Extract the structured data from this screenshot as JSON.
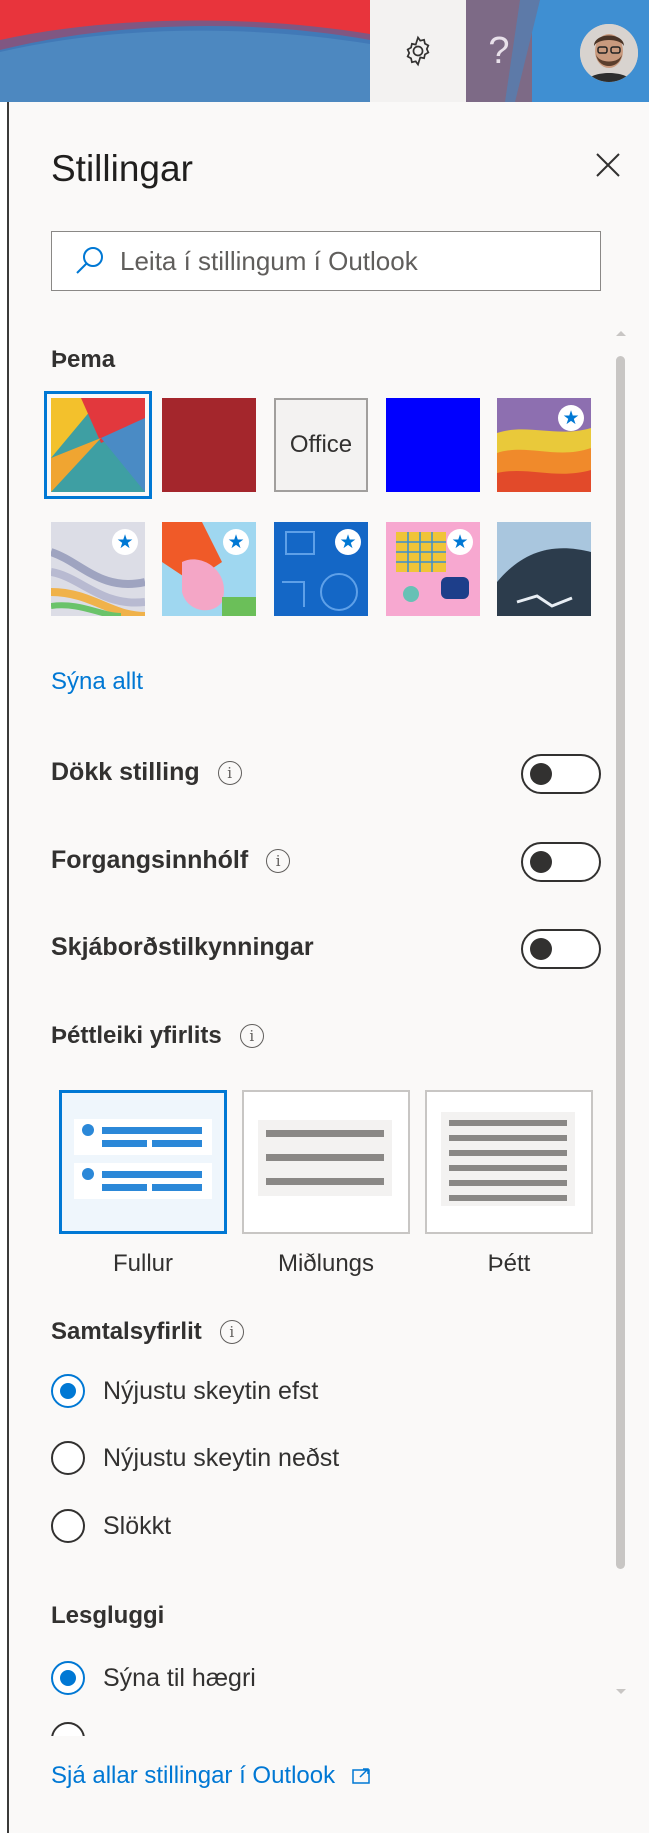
{
  "header": {
    "gear_label": "Settings",
    "help_label": "?",
    "colors": {
      "red": "#e8303a",
      "blue": "#4a86c5",
      "purple": "#7c6a87"
    }
  },
  "settings": {
    "title": "Stillingar",
    "close_icon": "close-icon",
    "search": {
      "placeholder": "Leita í stillingum í Outlook"
    },
    "theme": {
      "heading": "Þema",
      "office_label": "Office",
      "show_all": "Sýna allt"
    },
    "toggles": [
      {
        "label": "Dökk stilling",
        "info": "i",
        "on": false
      },
      {
        "label": "Forgangsinnhólf",
        "info": "i",
        "on": false
      },
      {
        "label": "Skjáborðstilkynningar",
        "on": false
      }
    ],
    "density": {
      "heading": "Þéttleiki yfirlits",
      "info": "i",
      "options": [
        "Fullur",
        "Miðlungs",
        "Þétt"
      ],
      "selected": "Fullur"
    },
    "conversation": {
      "heading": "Samtalsyfirlit",
      "info": "i",
      "options": [
        "Nýjustu skeytin efst",
        "Nýjustu skeytin neðst",
        "Slökkt"
      ],
      "selected": "Nýjustu skeytin efst"
    },
    "reading_pane": {
      "heading": "Lesgluggi",
      "options": [
        "Sýna til hægri"
      ],
      "selected": "Sýna til hægri"
    },
    "footer_link": "Sjá allar stillingar í Outlook",
    "accent": "#0078d4"
  }
}
